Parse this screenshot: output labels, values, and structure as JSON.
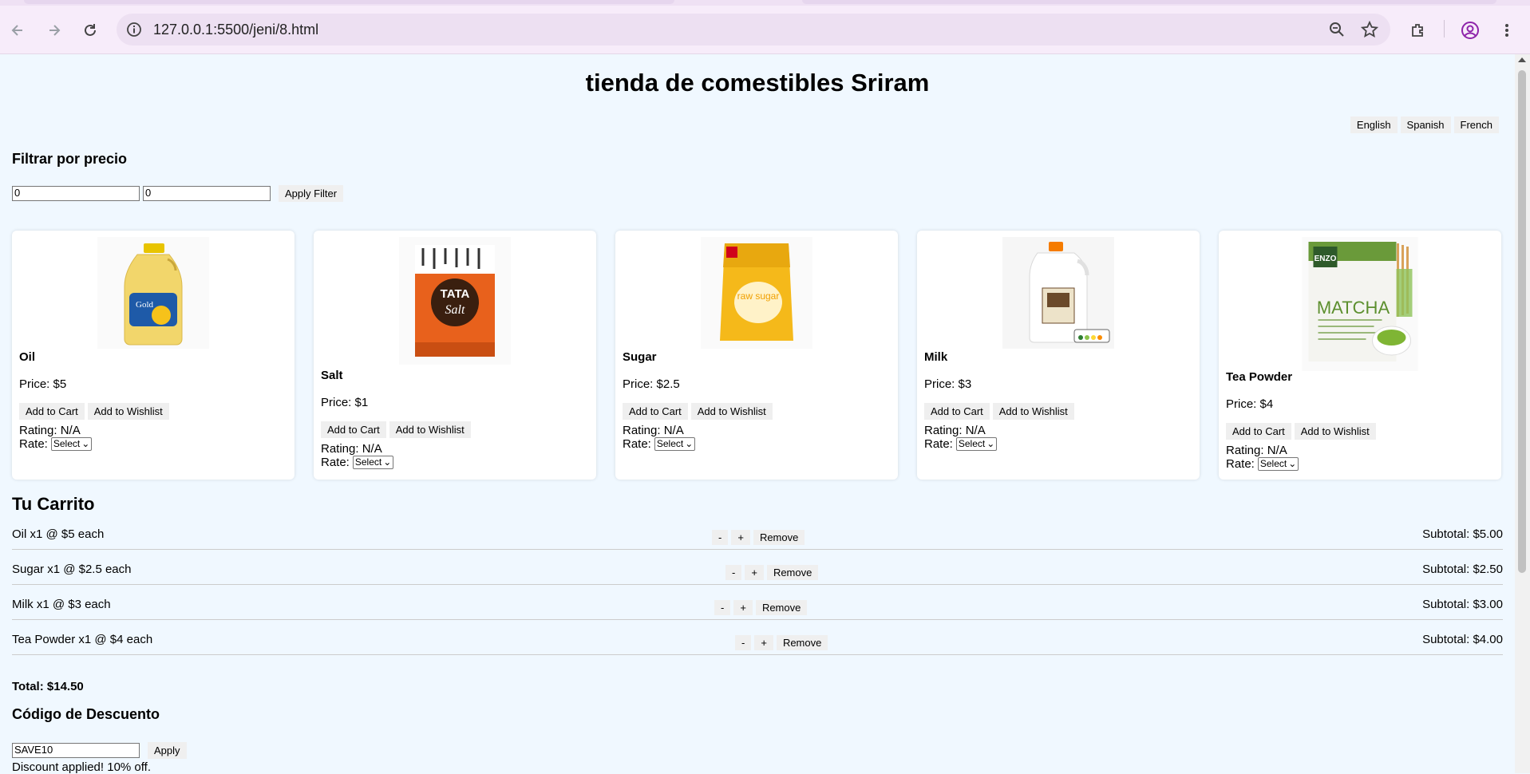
{
  "browser": {
    "url": "127.0.0.1:5500/jeni/8.html",
    "icons": [
      "back-icon",
      "forward-icon",
      "reload-icon",
      "site-info-icon",
      "zoom-icon",
      "bookmark-star-icon",
      "extensions-icon",
      "profile-icon",
      "menu-icon"
    ]
  },
  "page": {
    "title": "tienda de comestibles Sriram",
    "languages": [
      "English",
      "Spanish",
      "French"
    ],
    "filter": {
      "heading": "Filtrar por precio",
      "min_value": "0",
      "max_value": "0",
      "apply_label": "Apply Filter"
    },
    "products": [
      {
        "name": "Oil",
        "price": "Price: $5",
        "rating": "Rating: N/A",
        "rate_label": "Rate:",
        "rate_select": "Select",
        "image": "oil-bottle"
      },
      {
        "name": "Salt",
        "price": "Price: $1",
        "rating": "Rating: N/A",
        "rate_label": "Rate:",
        "rate_select": "Select",
        "image": "salt-packet"
      },
      {
        "name": "Sugar",
        "price": "Price: $2.5",
        "rating": "Rating: N/A",
        "rate_label": "Rate:",
        "rate_select": "Select",
        "image": "sugar-bag"
      },
      {
        "name": "Milk",
        "price": "Price: $3",
        "rating": "Rating: N/A",
        "rate_label": "Rate:",
        "rate_select": "Select",
        "image": "milk-jug"
      },
      {
        "name": "Tea Powder",
        "price": "Price: $4",
        "rating": "Rating: N/A",
        "rate_label": "Rate:",
        "rate_select": "Select",
        "image": "matcha-pouch"
      }
    ],
    "add_to_cart_label": "Add to Cart",
    "add_to_wishlist_label": "Add to Wishlist",
    "product_image_text": {
      "salt_brand": "TATA",
      "salt_word": "Salt",
      "sugar_text": "raw sugar",
      "matcha_brand": "ENZO",
      "matcha_word": "MATCHA"
    },
    "cart": {
      "heading": "Tu Carrito",
      "items": [
        {
          "desc": "Oil x1 @ $5 each",
          "subtotal": "Subtotal: $5.00"
        },
        {
          "desc": "Sugar x1 @ $2.5 each",
          "subtotal": "Subtotal: $2.50"
        },
        {
          "desc": "Milk x1 @ $3 each",
          "subtotal": "Subtotal: $3.00"
        },
        {
          "desc": "Tea Powder x1 @ $4 each",
          "subtotal": "Subtotal: $4.00"
        }
      ],
      "minus_label": "-",
      "plus_label": "+",
      "remove_label": "Remove",
      "total": "Total: $14.50"
    },
    "discount": {
      "heading": "Código de Descuento",
      "code_value": "SAVE10",
      "apply_label": "Apply",
      "message": "Discount applied! 10% off."
    }
  }
}
